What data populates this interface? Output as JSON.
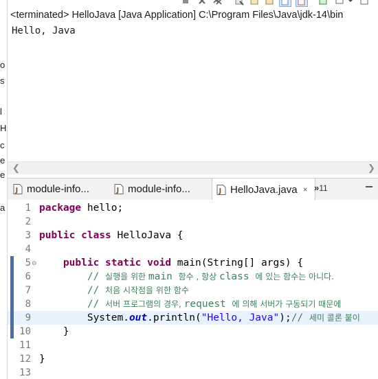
{
  "console": {
    "header": "<terminated> HelloJava [Java Application] C:\\Program Files\\Java\\jdk-14\\bin",
    "output": "Hello, Java"
  },
  "left_strip": [
    "o",
    "s",
    "l",
    "H",
    "c",
    "e",
    "e",
    "a"
  ],
  "tabs": [
    {
      "label": "module-info...",
      "active": false
    },
    {
      "label": "module-info...",
      "active": false
    },
    {
      "label": "HelloJava.java",
      "active": true,
      "close": "×"
    }
  ],
  "tab_overflow": {
    "symbol": "»",
    "count": "11"
  },
  "editor": {
    "lines": [
      {
        "num": "1",
        "segs": [
          [
            "kw",
            "package"
          ],
          [
            "",
            "hello;"
          ]
        ]
      },
      {
        "num": "2",
        "segs": []
      },
      {
        "num": "3",
        "segs": [
          [
            "kw",
            "public"
          ],
          [
            "kw",
            "class"
          ],
          [
            "",
            "HelloJava {"
          ]
        ]
      },
      {
        "num": "4",
        "segs": []
      },
      {
        "num": "5",
        "fold": "⊖",
        "segs": [
          [
            "",
            "    "
          ],
          [
            "kw",
            "public"
          ],
          [
            "kw",
            "static"
          ],
          [
            "kw",
            "void"
          ],
          [
            "",
            "main(String[] args) {"
          ]
        ]
      },
      {
        "num": "6",
        "segs": [
          [
            "",
            "        "
          ],
          [
            "cm",
            "// "
          ],
          [
            "cmk",
            "실행을 위한 "
          ],
          [
            "cm",
            "main "
          ],
          [
            "cmk",
            "함수 , 항상 "
          ],
          [
            "cm",
            "class "
          ],
          [
            "cmk",
            "에 있는 함수는 아니다."
          ]
        ]
      },
      {
        "num": "7",
        "segs": [
          [
            "",
            "        "
          ],
          [
            "cm",
            "// "
          ],
          [
            "cmk",
            "처음 시작점을 위한 함수"
          ]
        ]
      },
      {
        "num": "8",
        "segs": [
          [
            "",
            "        "
          ],
          [
            "cm",
            "// "
          ],
          [
            "cmk",
            "서버 프로그램의 경우, "
          ],
          [
            "cm",
            "request "
          ],
          [
            "cmk",
            "에 의해 서버가 구동되기 때문에"
          ]
        ]
      },
      {
        "num": "9",
        "current": true,
        "segs": [
          [
            "",
            "        System."
          ],
          [
            "fld",
            "out"
          ],
          [
            "",
            ".println("
          ],
          [
            "str",
            "\"Hello, Java\""
          ],
          [
            "",
            ");"
          ],
          [
            "cm",
            "// "
          ],
          [
            "cmk",
            "세미 콜론 붙이"
          ]
        ]
      },
      {
        "num": "10",
        "segs": [
          [
            "",
            "    }"
          ]
        ]
      },
      {
        "num": "11",
        "segs": []
      },
      {
        "num": "12",
        "segs": [
          [
            "",
            "}"
          ]
        ]
      },
      {
        "num": "13",
        "segs": []
      }
    ]
  }
}
